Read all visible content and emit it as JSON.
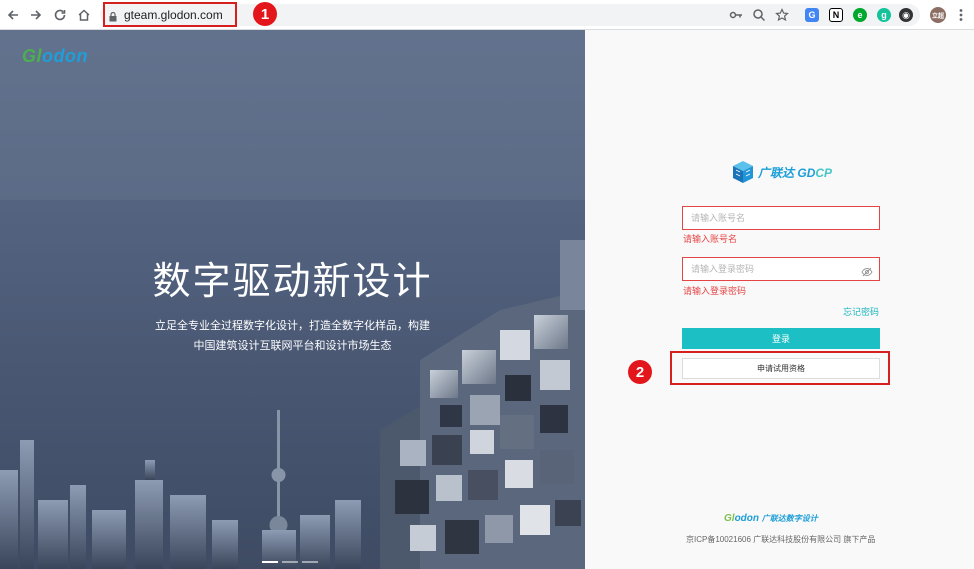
{
  "browser": {
    "url": "gteam.glodon.com",
    "profile_label": "立超"
  },
  "callouts": [
    "1",
    "2"
  ],
  "hero": {
    "logo": {
      "part1": "Gl",
      "part2": "odon"
    },
    "title": "数字驱动新设计",
    "subtitle_line1": "立足全专业全过程数字化设计，打造全数字化样品，构建",
    "subtitle_line2": "中国建筑设计互联网平台和设计市场生态"
  },
  "login": {
    "brand": {
      "name": "广联达",
      "product_a": "GD",
      "product_b": "CP"
    },
    "username": {
      "placeholder": "请输入账号名",
      "value": "",
      "error": "请输入账号名"
    },
    "password": {
      "placeholder": "请输入登录密码",
      "value": "",
      "error": "请输入登录密码"
    },
    "forgot_label": "忘记密码",
    "login_label": "登录",
    "apply_label": "申请试用资格"
  },
  "footer": {
    "logo_a": "Gl",
    "logo_b": "odon",
    "logo_zh": "广联达数字设计",
    "icp": "京ICP备10021606 广联达科技股份有限公司 旗下产品"
  },
  "colors": {
    "accent": "#1bbfc4",
    "error": "#e64545",
    "annotation": "#d62020"
  }
}
